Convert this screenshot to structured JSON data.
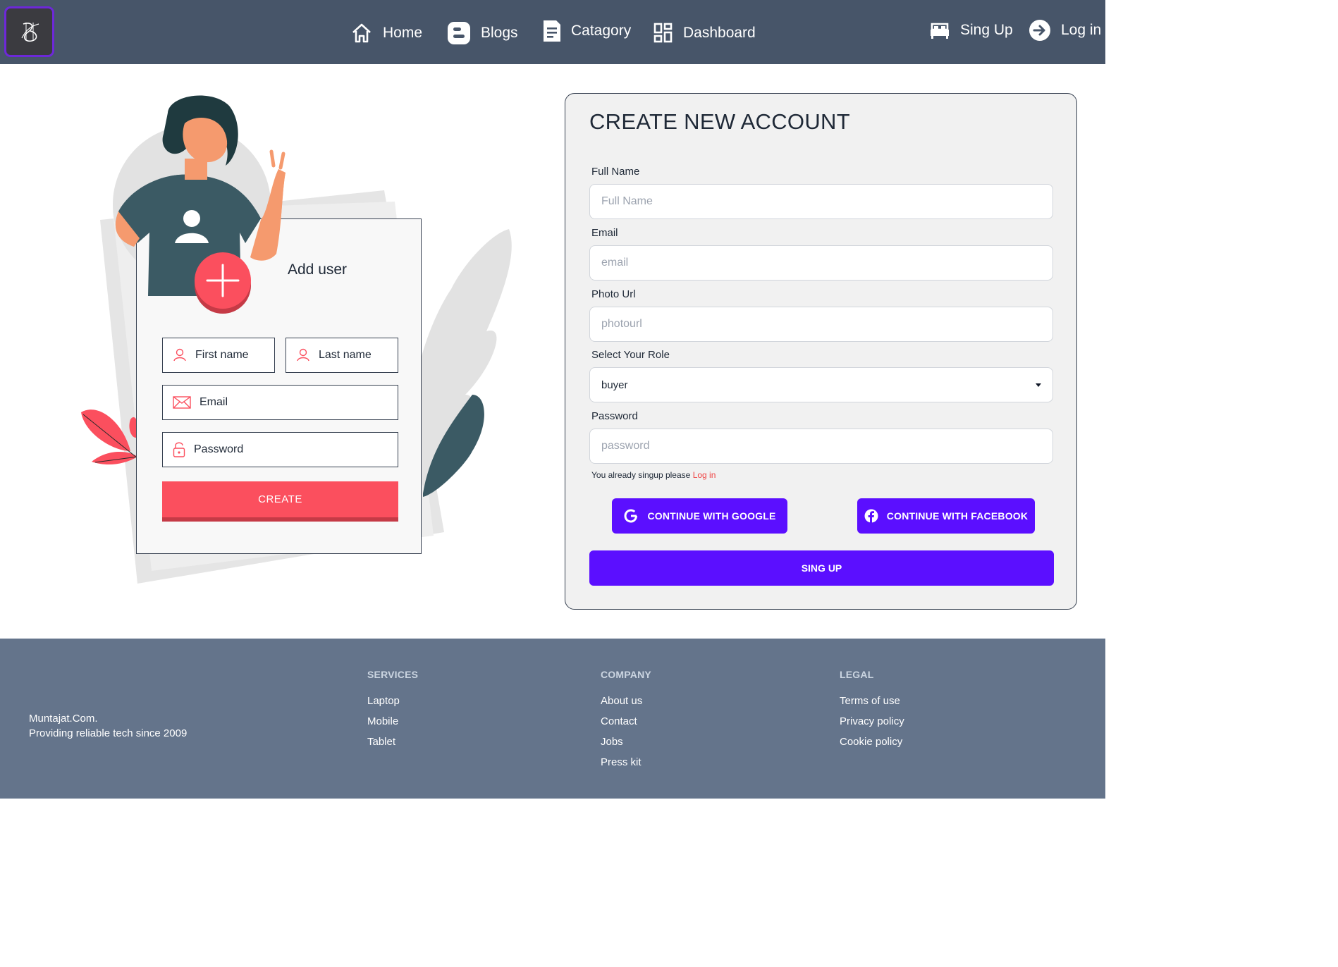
{
  "nav": {
    "home": "Home",
    "blogs": "Blogs",
    "category": "Catagory",
    "dashboard": "Dashboard",
    "signup": "Sing Up",
    "login": "Log in"
  },
  "illustration": {
    "title": "Add user",
    "first_name": "First name",
    "last_name": "Last name",
    "email": "Email",
    "password": "Password",
    "create": "CREATE"
  },
  "form": {
    "title": "CREATE NEW ACCOUNT",
    "full_name_label": "Full Name",
    "full_name_placeholder": "Full Name",
    "email_label": "Email",
    "email_placeholder": "email",
    "photo_label": "Photo Url",
    "photo_placeholder": "photourl",
    "role_label": "Select Your Role",
    "role_value": "buyer",
    "password_label": "Password",
    "password_placeholder": "password",
    "note": "You already singup please",
    "note_link": "Log in",
    "google": "CONTINUE WITH GOOGLE",
    "facebook": "CONTINUE WITH FACEBOOK",
    "submit": "SING UP"
  },
  "footer": {
    "brand_name": "Muntajat.Com.",
    "brand_tagline": "Providing reliable tech since 2009",
    "services_title": "SERVICES",
    "services": [
      "Laptop",
      "Mobile",
      "Tablet"
    ],
    "company_title": "COMPANY",
    "company": [
      "About us",
      "Contact",
      "Jobs",
      "Press kit"
    ],
    "legal_title": "LEGAL",
    "legal": [
      "Terms of use",
      "Privacy policy",
      "Cookie policy"
    ]
  },
  "colors": {
    "navbar": "#475569",
    "footer": "#64748b",
    "primary_button": "#5b0fff",
    "illustration_accent": "#fb4f5e"
  },
  "icons": {
    "home": "home-icon",
    "blogs": "blogger-icon",
    "category": "document-icon",
    "dashboard": "dashboard-grid-icon",
    "signup": "bed-icon",
    "login": "login-arrow-icon",
    "google": "google-icon",
    "facebook": "facebook-icon"
  }
}
